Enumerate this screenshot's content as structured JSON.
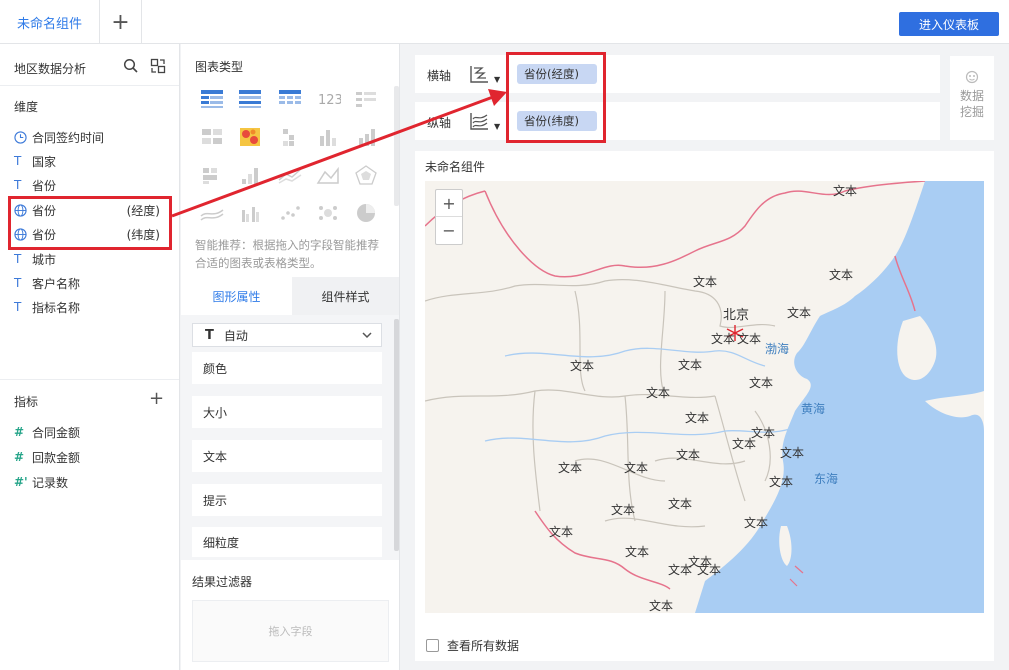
{
  "topbar": {
    "tab_label": "未命名组件",
    "add_tab": "+",
    "dashboard_button": "进入仪表板"
  },
  "left": {
    "title": "地区数据分析",
    "dimension_label": "维度",
    "dimensions": [
      {
        "type": "time",
        "label": "合同签约时间",
        "sub": ""
      },
      {
        "type": "text",
        "label": "国家",
        "sub": ""
      },
      {
        "type": "text",
        "label": "省份",
        "sub": ""
      },
      {
        "type": "geo",
        "label": "省份",
        "sub": "(经度)"
      },
      {
        "type": "geo",
        "label": "省份",
        "sub": "(纬度)"
      },
      {
        "type": "text",
        "label": "城市",
        "sub": ""
      },
      {
        "type": "text",
        "label": "客户名称",
        "sub": ""
      },
      {
        "type": "text",
        "label": "指标名称",
        "sub": ""
      }
    ],
    "metric_label": "指标",
    "metric_add": "+",
    "metrics": [
      {
        "icon": "#",
        "label": "合同金额"
      },
      {
        "icon": "#",
        "label": "回款金额"
      },
      {
        "icon": "#'",
        "label": "记录数"
      }
    ]
  },
  "middle": {
    "chart_type_label": "图表类型",
    "hint": "智能推荐：根据拖入的字段智能推荐合适的图表或表格类型。",
    "tab_shape": "图形属性",
    "tab_style": "组件样式",
    "select_value": "自动",
    "select_icon": "T",
    "props": [
      "颜色",
      "大小",
      "文本",
      "提示",
      "细粒度"
    ],
    "filter_label": "结果过滤器",
    "filter_placeholder": "拖入字段"
  },
  "axis": {
    "x_label": "横轴",
    "x_value": "省份(经度)",
    "y_label": "纵轴",
    "y_value": "省份(纬度)"
  },
  "mining": {
    "line1": "数据",
    "line2": "挖掘"
  },
  "card": {
    "title": "未命名组件",
    "zoom_in": "+",
    "zoom_out": "−",
    "show_all": "查看所有数据",
    "text_label": "文本",
    "city_label": "北京",
    "sea_bohai": "渤海",
    "sea_huang": "黄海",
    "sea_dong": "东海"
  },
  "colors": {
    "accent": "#2f7be8",
    "button_blue": "#2f6fe0",
    "annotation_red": "#e0252f",
    "pill": "#c8d7f3",
    "sea": "#a9cdf3",
    "land": "#f6f3ee"
  }
}
